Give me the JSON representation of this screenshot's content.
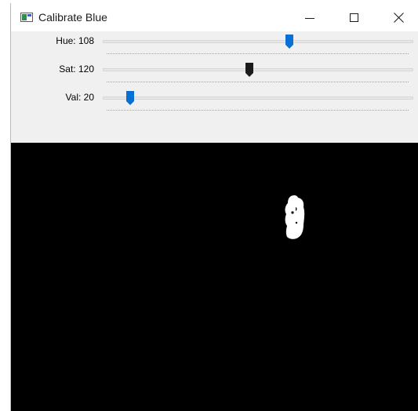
{
  "window": {
    "title": "Calibrate Blue",
    "controls": {
      "minimize": "minimize-icon",
      "maximize": "maximize-icon",
      "close": "close-icon"
    }
  },
  "trackbars": [
    {
      "label": "Hue: 108",
      "value": 108,
      "max": 179,
      "thumb_color": "#0a6fd4",
      "active": false
    },
    {
      "label": "Sat: 120",
      "value": 120,
      "max": 255,
      "thumb_color": "#1b1b1b",
      "active": true
    },
    {
      "label": "Val: 20",
      "value": 20,
      "max": 255,
      "thumb_color": "#0a6fd4",
      "active": false
    }
  ],
  "image": {
    "description_color_background": "#000000",
    "description_color_foreground": "#ffffff"
  },
  "colors": {
    "thumb_blue": "#0a6fd4",
    "thumb_focused": "#1b1b1b",
    "panel_bg": "#f0f0f0",
    "mask_bg": "#000000",
    "mask_fg": "#ffffff"
  }
}
